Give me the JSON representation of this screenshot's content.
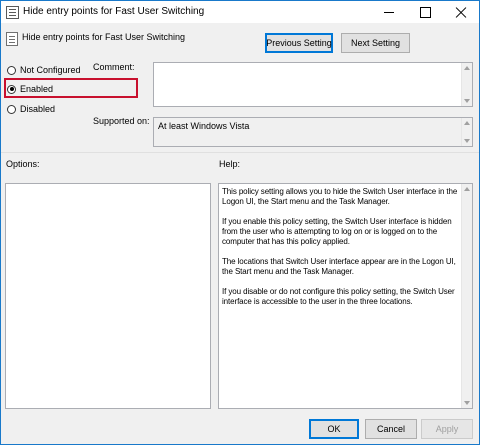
{
  "window": {
    "title": "Hide entry points for Fast User Switching"
  },
  "header": {
    "policy_name": "Hide entry points for Fast User Switching",
    "previous_label": "Previous Setting",
    "next_label": "Next Setting"
  },
  "state": {
    "options": [
      {
        "label": "Not Configured",
        "checked": false
      },
      {
        "label": "Enabled",
        "checked": true
      },
      {
        "label": "Disabled",
        "checked": false
      }
    ]
  },
  "comment": {
    "label": "Comment:",
    "value": ""
  },
  "supported": {
    "label": "Supported on:",
    "value": "At least Windows Vista"
  },
  "options_panel": {
    "label": "Options:"
  },
  "help": {
    "label": "Help:",
    "paragraphs": [
      "This policy setting allows you to hide the Switch User interface in the Logon UI, the Start menu and the Task Manager.",
      "If you enable this policy setting, the Switch User interface is hidden from the user who is attempting to log on or is logged on to the computer that has this policy applied.",
      "The locations that Switch User interface appear are in the Logon UI, the Start menu and the Task Manager.",
      "If you disable or do not configure this policy setting, the Switch User interface is accessible to the user in the three locations."
    ]
  },
  "footer": {
    "ok_label": "OK",
    "cancel_label": "Cancel",
    "apply_label": "Apply"
  },
  "colors": {
    "window_border": "#1979ca",
    "highlight_box": "#c8102e",
    "default_button_border": "#0078d7"
  }
}
